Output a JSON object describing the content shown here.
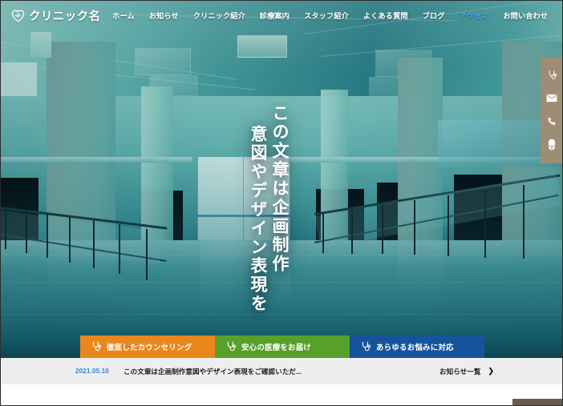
{
  "site": {
    "logo_text": "クリニック名",
    "logo_icon": "heart-handshake-icon"
  },
  "nav": {
    "items": [
      {
        "label": "ホーム",
        "active": false
      },
      {
        "label": "お知らせ",
        "active": false
      },
      {
        "label": "クリニック紹介",
        "active": false
      },
      {
        "label": "診療案内",
        "active": false
      },
      {
        "label": "スタッフ紹介",
        "active": false
      },
      {
        "label": "よくある質問",
        "active": false
      },
      {
        "label": "ブログ",
        "active": false
      },
      {
        "label": "アクセス",
        "active": true
      },
      {
        "label": "お問い合わせ",
        "active": false
      }
    ],
    "active_color": "#4ea3ff"
  },
  "hero": {
    "vertical_lines": [
      "この文章は企画制作",
      "意図やデザイン表現を"
    ],
    "image_description": "teal-tinted architectural interior with glossy floor and railings"
  },
  "side_rail": {
    "background": "#9d8d74",
    "buttons": [
      {
        "icon": "stethoscope-icon",
        "name": "medical-consult"
      },
      {
        "icon": "envelope-icon",
        "name": "email-contact"
      },
      {
        "icon": "phone-icon",
        "name": "phone-contact"
      },
      {
        "icon": "capsule-pill-icon",
        "name": "pharmacy-info"
      }
    ]
  },
  "cta": {
    "items": [
      {
        "label": "徹底したカウンセリング",
        "color": "#e8871e",
        "icon": "stethoscope-icon"
      },
      {
        "label": "安心の医療をお届け",
        "color": "#56a02b",
        "icon": "stethoscope-icon"
      },
      {
        "label": "あらゆるお悩みに対応",
        "color": "#15549b",
        "icon": "stethoscope-icon"
      }
    ]
  },
  "news": {
    "date": "2021.05.10",
    "date_color": "#2f85d0",
    "headline": "この文章は企画制作意図やデザイン表現をご確認いただ...",
    "more_label": "お知らせ一覧",
    "more_chevron": "❯",
    "background": "#eeeeee"
  },
  "footer": {
    "pagetop_color": "#6b5b4a"
  }
}
